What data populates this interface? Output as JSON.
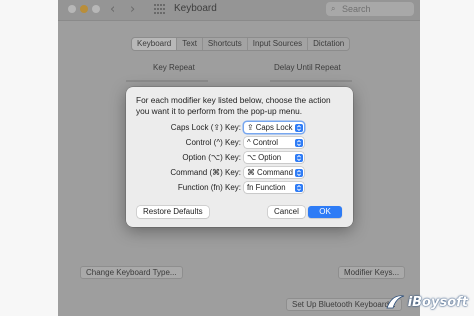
{
  "window": {
    "title": "Keyboard",
    "search_placeholder": "Search",
    "tabs": [
      {
        "label": "Keyboard",
        "active": true
      },
      {
        "label": "Text",
        "active": false
      },
      {
        "label": "Shortcuts",
        "active": false
      },
      {
        "label": "Input Sources",
        "active": false
      },
      {
        "label": "Dictation",
        "active": false
      }
    ],
    "key_repeat_label": "Key Repeat",
    "delay_label": "Delay Until Repeat",
    "change_keyboard_type_label": "Change Keyboard Type...",
    "modifier_keys_label": "Modifier Keys...",
    "bluetooth_label": "Set Up Bluetooth Keyboard..."
  },
  "dialog": {
    "message": "For each modifier key listed below, choose the action you want it to perform from the pop-up menu.",
    "rows": [
      {
        "label": "Caps Lock (⇪) Key:",
        "value": "⇪ Caps Lock",
        "focused": true
      },
      {
        "label": "Control (^) Key:",
        "value": "^ Control",
        "focused": false
      },
      {
        "label": "Option (⌥) Key:",
        "value": "⌥ Option",
        "focused": false
      },
      {
        "label": "Command (⌘) Key:",
        "value": "⌘ Command",
        "focused": false
      },
      {
        "label": "Function (fn) Key:",
        "value": "fn Function",
        "focused": false
      }
    ],
    "restore_label": "Restore Defaults",
    "cancel_label": "Cancel",
    "ok_label": "OK"
  },
  "colors": {
    "accent": "#2e7cf6",
    "focus_ring": "#78a7ef"
  },
  "watermark": {
    "text": "iBoysoft"
  }
}
